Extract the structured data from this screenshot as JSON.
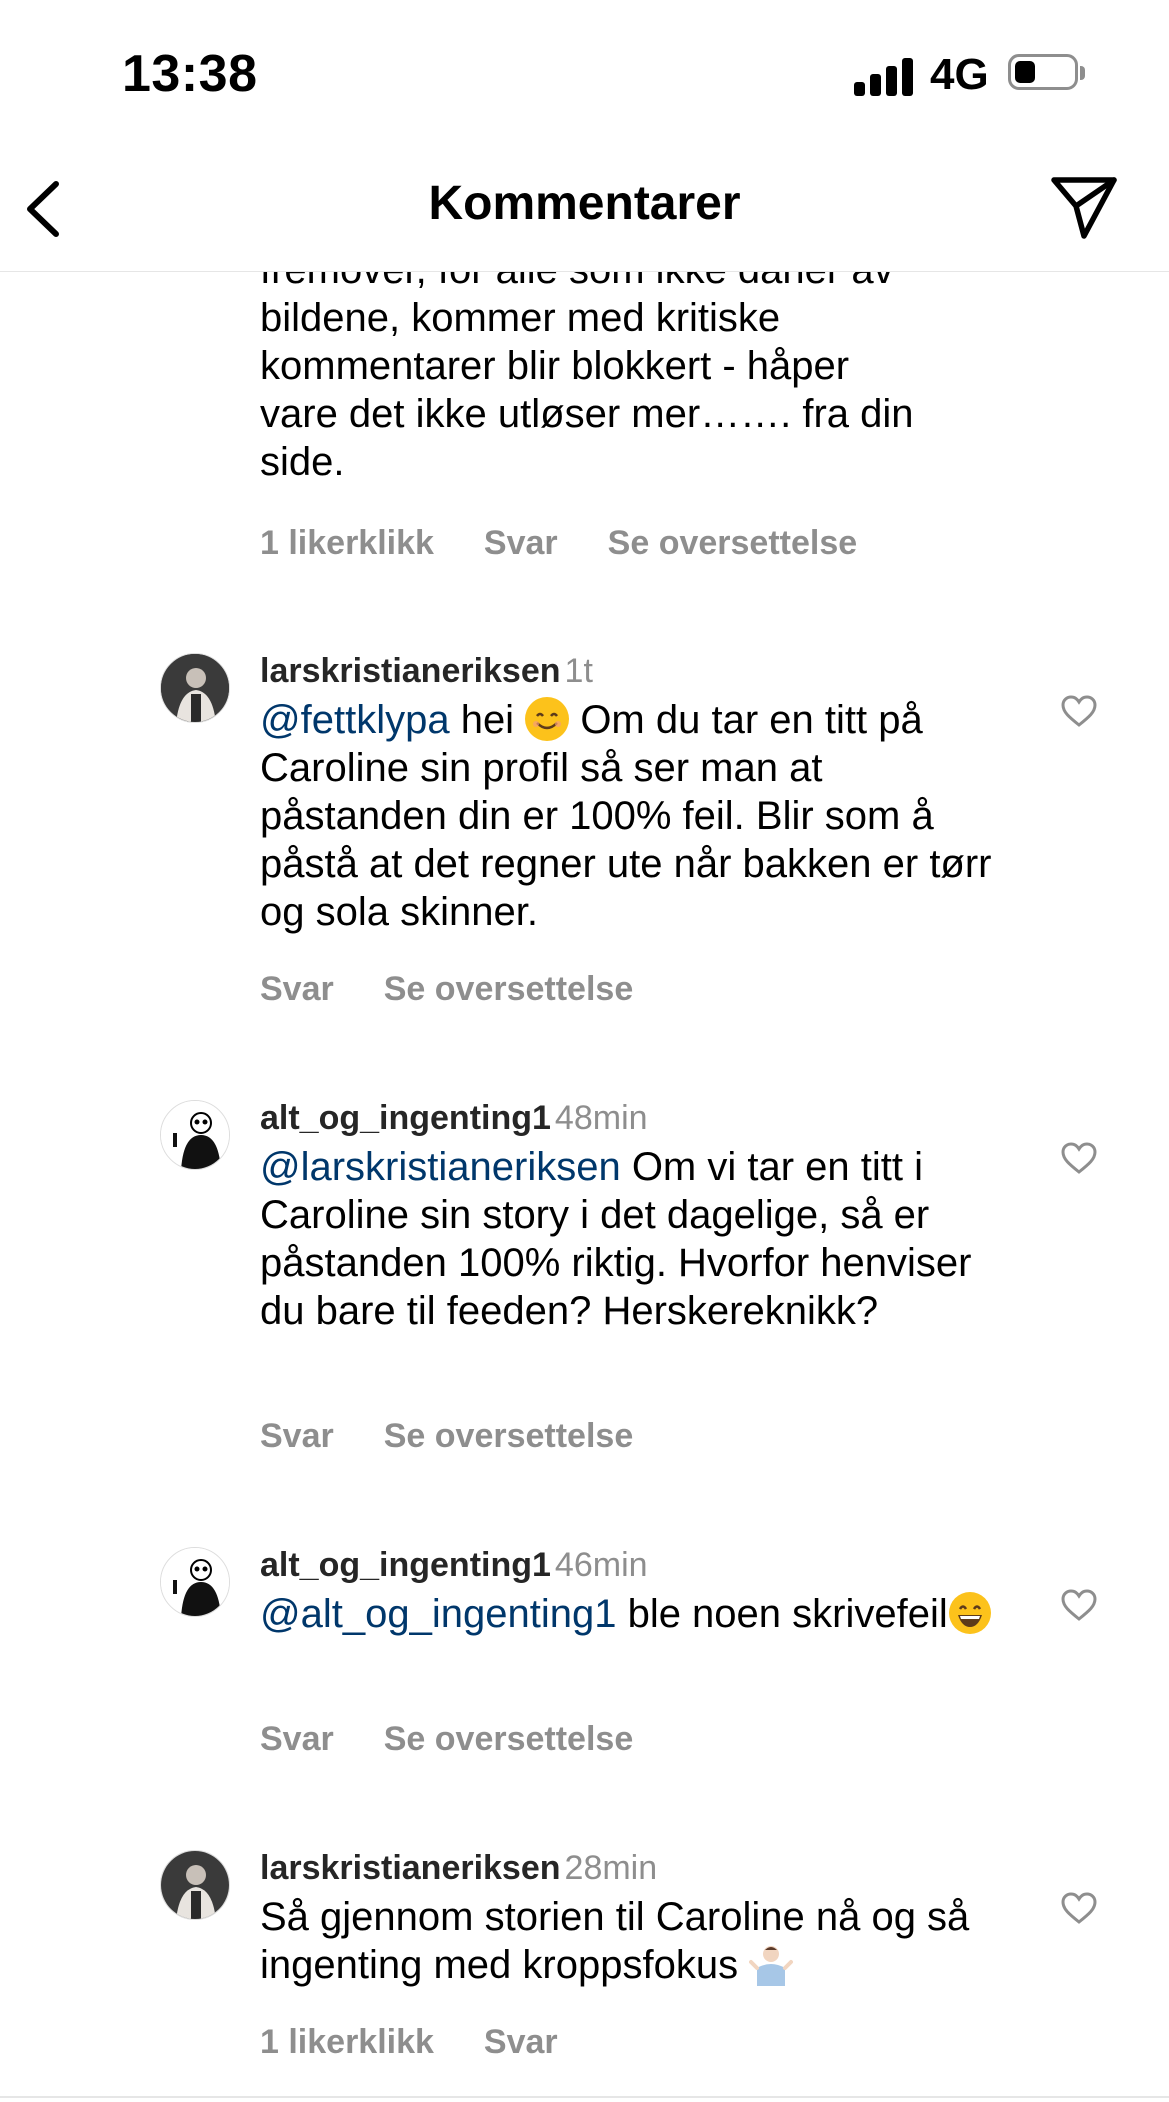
{
  "status_bar": {
    "time": "13:38",
    "network": "4G",
    "battery_percent": 20
  },
  "header": {
    "title": "Kommentarer",
    "back_icon": "chevron-left-icon",
    "send_icon": "paper-plane-icon"
  },
  "partial_comment": {
    "text_lines": [
      "fremover, for alle som ikke daner av",
      "bildene, kommer med kritiske",
      "kommentarer blir blokkert - håper",
      "vare det ikke utløser mer……. fra din",
      "side."
    ],
    "likes": "1 likerklikk",
    "reply": "Svar",
    "translate": "Se oversettelse"
  },
  "comments": [
    {
      "username": "larskristianeriksen",
      "time": "1t",
      "mention": "@fettklypa",
      "text_after_mention": " hei",
      "emoji_1": "😊",
      "text_rest": " Om du tar en titt på Caroline sin profil så ser man at påstanden din er 100% feil. Blir som å påstå at det regner ute når bakken er tørr og sola skinner.",
      "reply": "Svar",
      "translate": "Se oversettelse"
    },
    {
      "username": "alt_og_ingenting1",
      "time": "48min",
      "mention": "@larskristianeriksen",
      "text": " Om vi tar en titt i Caroline sin story i det dagelige, så er påstanden 100% riktig. Hvorfor henviser du bare til feeden? Herskereknikk?",
      "reply": "Svar",
      "translate": "Se oversettelse"
    },
    {
      "username": "alt_og_ingenting1",
      "time": "46min",
      "mention": "@alt_og_ingenting1",
      "text": " ble noen skrivefeil",
      "emoji": "😄",
      "reply": "Svar",
      "translate": "Se oversettelse"
    },
    {
      "username": "larskristianeriksen",
      "time": "28min",
      "text": "Så gjennom storien til Caroline nå og så ingenting med kroppsfokus",
      "emoji": "🤷🏻‍♂️",
      "likes": "1 likerklikk",
      "reply": "Svar"
    }
  ]
}
